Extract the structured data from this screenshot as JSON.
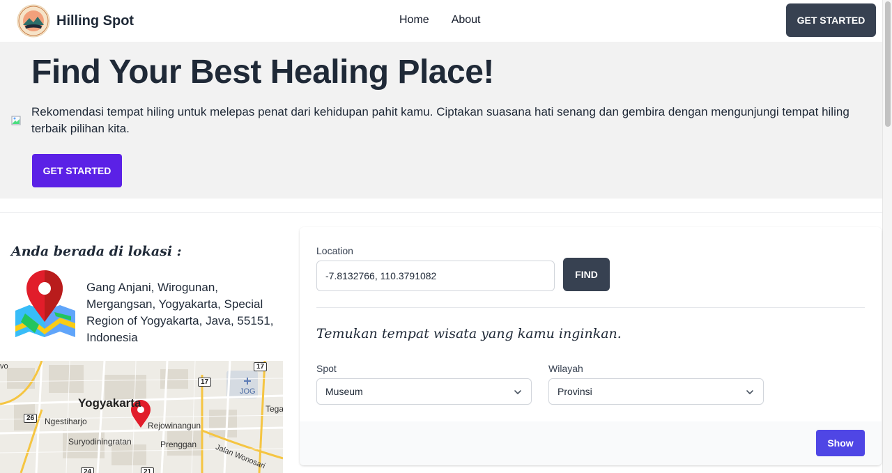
{
  "navbar": {
    "brand_name": "Hilling Spot",
    "links": [
      "Home",
      "About"
    ],
    "cta_label": "GET STARTED"
  },
  "hero": {
    "title": "Find Your Best Healing Place!",
    "description": "Rekomendasi tempat hiling untuk melepas penat dari kehidupan pahit kamu. Ciptakan suasana hati senang dan gembira dengan mengunjungi tempat hiling terbaik pilihan kita.",
    "cta_label": "GET STARTED"
  },
  "location_panel": {
    "heading": "Anda berada di lokasi :",
    "address": "Gang Anjani, Wirogunan, Mergangsan, Yogyakarta, Special Region of Yogyakarta, Java, 55151, Indonesia",
    "map": {
      "labels": [
        "Yogyakarta",
        "Ngestiharjo",
        "Rejowinangun",
        "Suryodiningratan",
        "Prenggan",
        "Jalan Wonosari",
        "Tega",
        "JOG",
        "vo"
      ],
      "road_numbers": [
        "17",
        "17",
        "26",
        "24",
        "21"
      ]
    }
  },
  "search_form": {
    "location_label": "Location",
    "location_value": "-7.8132766, 110.3791082",
    "find_label": "FIND",
    "subheading": "Temukan tempat wisata yang kamu inginkan.",
    "spot_label": "Spot",
    "spot_value": "Museum",
    "region_label": "Wilayah",
    "region_value": "Provinsi",
    "show_label": "Show"
  },
  "colors": {
    "nav_button": "#374151",
    "hero_button": "#5b21e6",
    "show_button": "#4f46e5",
    "hero_bg": "#f2f2f2",
    "pin_red": "#e11d2a"
  }
}
